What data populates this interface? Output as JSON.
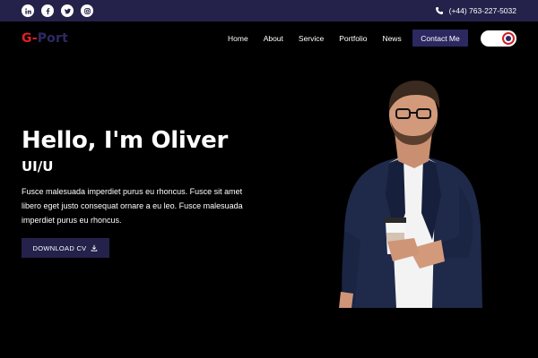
{
  "topbar": {
    "socials": [
      {
        "icon": "linkedin-icon",
        "glyph": "in"
      },
      {
        "icon": "facebook-icon",
        "glyph": "f"
      },
      {
        "icon": "twitter-icon",
        "glyph": "t"
      },
      {
        "icon": "instagram-icon",
        "glyph": "ig"
      }
    ],
    "phone": "(+44) 763-227-5032"
  },
  "navbar": {
    "logo_first": "G-",
    "logo_rest": "Port",
    "links": [
      "Home",
      "About",
      "Service",
      "Portfolio",
      "News"
    ],
    "contact_label": "Contact Me"
  },
  "hero": {
    "title": "Hello, I'm Oliver",
    "subtitle": "UI/U",
    "description": "Fusce malesuada imperdiet purus eu rhoncus. Fusce sit amet libero eget justo consequat ornare a eu leo. Fusce malesuada imperdiet purus eu rhoncus.",
    "download_label": "DOWNLOAD CV"
  },
  "colors": {
    "topbar_bg": "#24224a",
    "accent": "#2b2960",
    "logo_red": "#e02020",
    "background": "#000000"
  }
}
